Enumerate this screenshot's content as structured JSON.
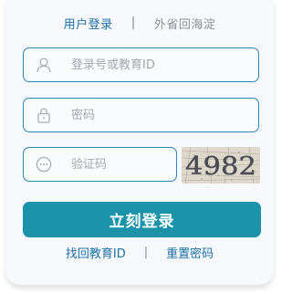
{
  "tabs": {
    "active": "用户登录",
    "separator": "|",
    "other": "外省回海淀"
  },
  "form": {
    "username_placeholder": "登录号或教育ID",
    "password_placeholder": "密码",
    "captcha_placeholder": "验证码",
    "captcha_text": "4982",
    "login_button": "立刻登录"
  },
  "links": {
    "recover_id": "找回教育ID",
    "separator": "|",
    "reset_password": "重置密码"
  },
  "colors": {
    "accent": "#1c93a8",
    "border": "#2c86b7",
    "link": "#1d6fa5",
    "muted": "#8a8f96"
  },
  "icons": {
    "username": "user-icon",
    "password": "lock-icon",
    "captcha": "ellipsis-icon"
  }
}
